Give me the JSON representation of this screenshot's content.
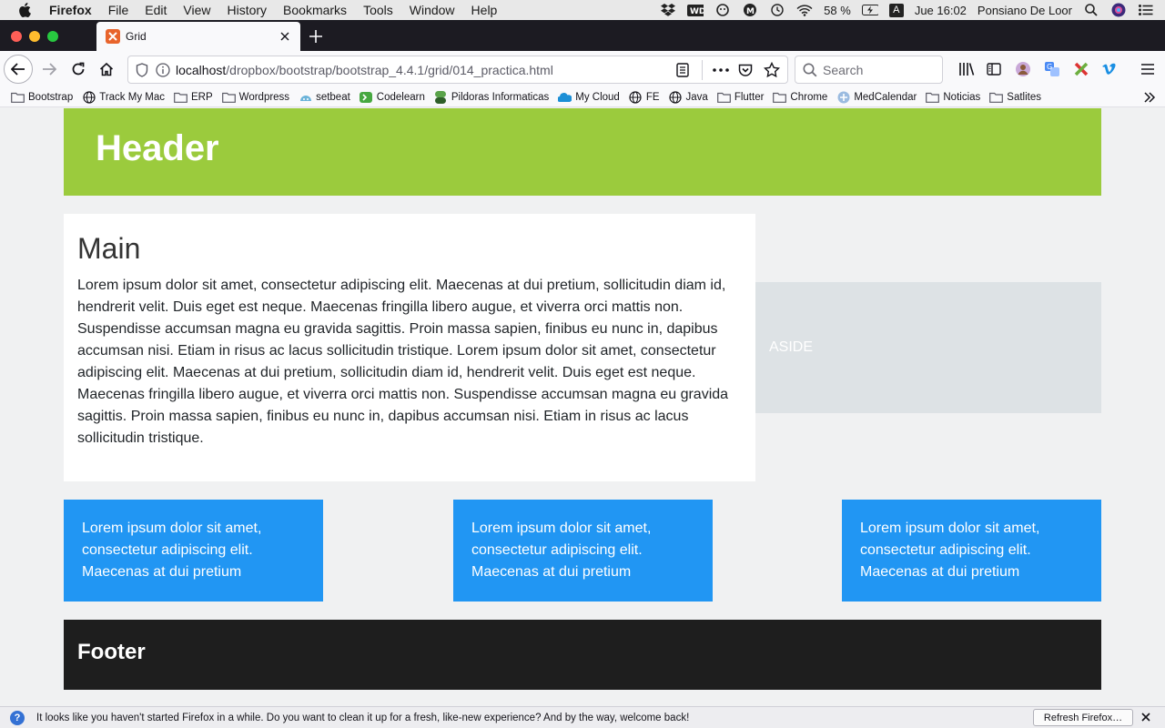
{
  "menubar": {
    "app_name": "Firefox",
    "items": [
      "File",
      "Edit",
      "View",
      "History",
      "Bookmarks",
      "Tools",
      "Window",
      "Help"
    ],
    "battery": "58 %",
    "input_source": "A",
    "clock": "Jue 16:02",
    "user": "Ponsiano De Loor"
  },
  "browser": {
    "tab_title": "Grid",
    "url_host": "localhost",
    "url_path": "/dropbox/bootstrap/bootstrap_4.4.1/grid/014_practica.html",
    "search_placeholder": "Search"
  },
  "bookmarks": [
    {
      "label": "Bootstrap",
      "icon": "folder-icon"
    },
    {
      "label": "Track My Mac",
      "icon": "globe-icon"
    },
    {
      "label": "ERP",
      "icon": "folder-icon"
    },
    {
      "label": "Wordpress",
      "icon": "folder-icon"
    },
    {
      "label": "setbeat",
      "icon": "setbeat-icon"
    },
    {
      "label": "Codelearn",
      "icon": "codelearn-icon"
    },
    {
      "label": "Pildoras Informaticas",
      "icon": "pildoras-icon"
    },
    {
      "label": "My Cloud",
      "icon": "cloud-icon"
    },
    {
      "label": "FE",
      "icon": "globe-icon"
    },
    {
      "label": "Java",
      "icon": "globe-icon"
    },
    {
      "label": "Flutter",
      "icon": "folder-icon"
    },
    {
      "label": "Chrome",
      "icon": "folder-icon"
    },
    {
      "label": "MedCalendar",
      "icon": "medcalendar-icon"
    },
    {
      "label": "Noticias",
      "icon": "folder-icon"
    },
    {
      "label": "Satlites",
      "icon": "folder-icon"
    }
  ],
  "page": {
    "header_title": "Header",
    "main_title": "Main",
    "main_text": "Lorem ipsum dolor sit amet, consectetur adipiscing elit. Maecenas at dui pretium, sollicitudin diam id, hendrerit velit. Duis eget est neque. Maecenas fringilla libero augue, et viverra orci mattis non. Suspendisse accumsan magna eu gravida sagittis. Proin massa sapien, finibus eu nunc in, dapibus accumsan nisi. Etiam in risus ac lacus sollicitudin tristique. Lorem ipsum dolor sit amet, consectetur adipiscing elit. Maecenas at dui pretium, sollicitudin diam id, hendrerit velit. Duis eget est neque. Maecenas fringilla libero augue, et viverra orci mattis non. Suspendisse accumsan magna eu gravida sagittis. Proin massa sapien, finibus eu nunc in, dapibus accumsan nisi. Etiam in risus ac lacus sollicitudin tristique.",
    "aside_label": "ASIDE",
    "cards": [
      "Lorem ipsum dolor sit amet, consectetur adipiscing elit. Maecenas at dui pretium",
      "Lorem ipsum dolor sit amet, consectetur adipiscing elit. Maecenas at dui pretium",
      "Lorem ipsum dolor sit amet, consectetur adipiscing elit. Maecenas at dui pretium"
    ],
    "footer_title": "Footer"
  },
  "notification": {
    "message": "It looks like you haven't started Firefox in a while. Do you want to clean it up for a fresh, like-new experience? And by the way, welcome back!",
    "button_label": "Refresh Firefox…"
  },
  "colors": {
    "header_bg": "#9bcb3d",
    "card_bg": "#2196f3",
    "aside_bg": "#dde2e5",
    "footer_bg": "#1e1e1e"
  }
}
